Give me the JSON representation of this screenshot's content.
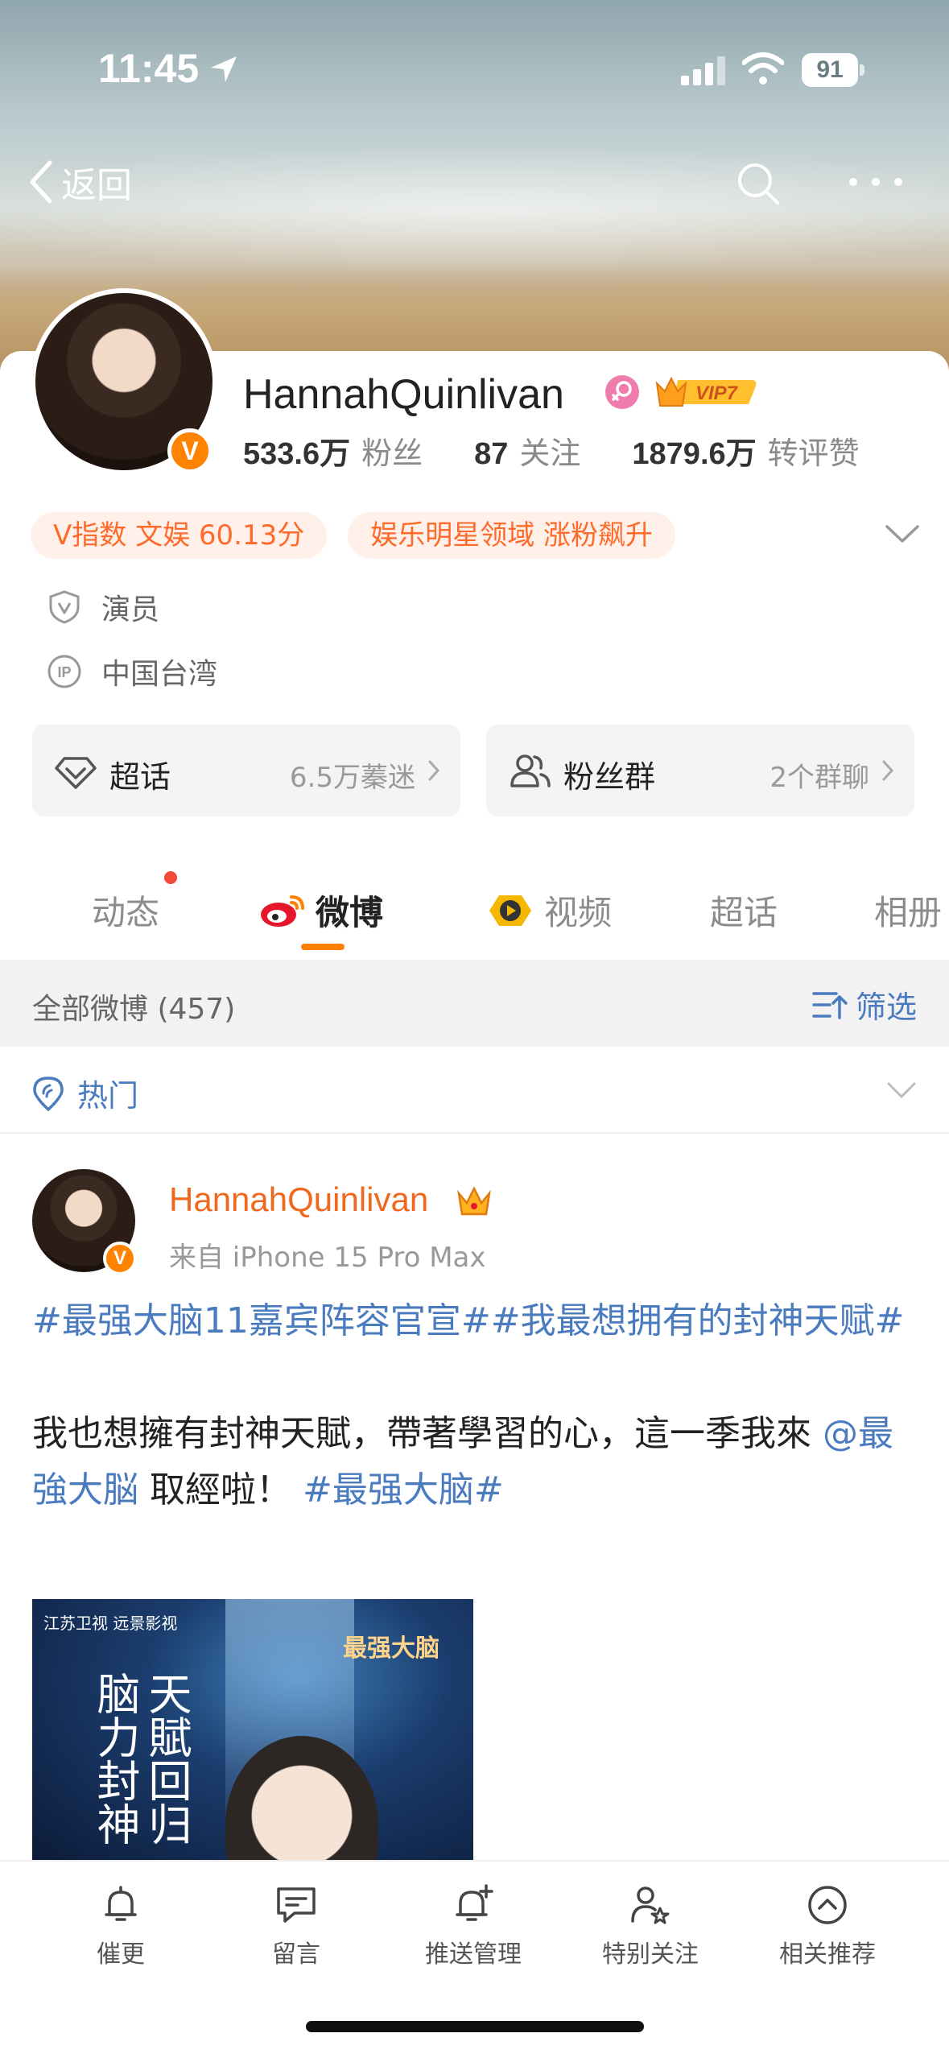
{
  "status_bar": {
    "time": "11:45",
    "battery": "91"
  },
  "nav": {
    "back_label": "返回"
  },
  "profile": {
    "name": "HannahQuinlivan",
    "vip_label": "VIP7",
    "stats": [
      {
        "value": "533.6万",
        "label": "粉丝"
      },
      {
        "value": "87",
        "label": "关注"
      },
      {
        "value": "1879.6万",
        "label": "转评赞"
      }
    ],
    "chips": [
      "V指数 文娱 60.13分",
      "娱乐明星领域 涨粉飙升"
    ],
    "occupation": "演员",
    "ip_location": "中国台湾",
    "entries": [
      {
        "title": "超话",
        "sub": "6.5万蓁迷"
      },
      {
        "title": "粉丝群",
        "sub": "2个群聊"
      }
    ]
  },
  "tabs": [
    "动态",
    "微博",
    "视频",
    "超话",
    "相册"
  ],
  "feed": {
    "count_label": "全部微博 (457)",
    "filter_label": "筛选",
    "sort_label": "热门"
  },
  "post": {
    "author": "HannahQuinlivan",
    "source": "来自 iPhone 15 Pro Max",
    "topic1": "#最强大脑11嘉宾阵容官宣#",
    "topic2": "#我最想拥有的封神天赋#",
    "body1": "我也想擁有封神天賦，帶著學習的心，這一季我來",
    "mention": "@最強大脳",
    "body2": " 取經啦！",
    "topic3": "#最强大脑#",
    "image_text": {
      "logo_left": "江苏卫视 远景影视",
      "logo_right": "最强大脑",
      "calligraphy": "天賦回归脑力封神"
    }
  },
  "bottom_bar": [
    "催更",
    "留言",
    "推送管理",
    "特别关注",
    "相关推荐"
  ],
  "colors": {
    "accent": "#ff8200",
    "link": "#4a7bbf",
    "chip_text": "#ff6a2b"
  }
}
